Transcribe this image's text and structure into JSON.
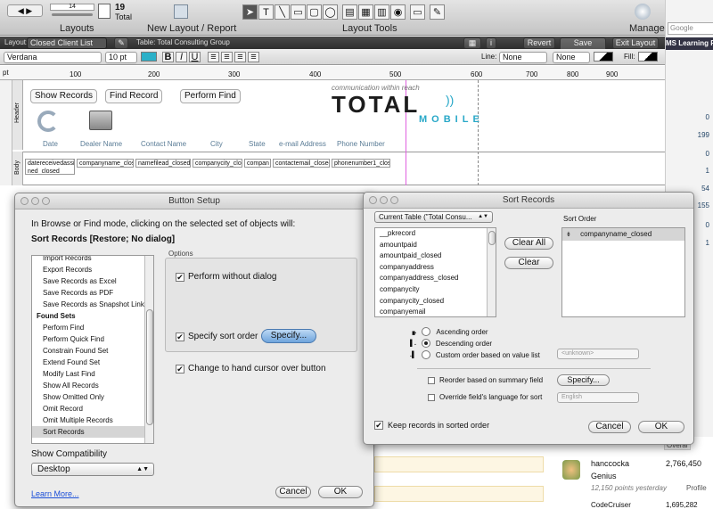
{
  "toolbar": {
    "record_number": "14",
    "record_count": "19",
    "record_total_label": "Total",
    "layouts_label": "Layouts",
    "new_layout_label": "New Layout / Report",
    "layout_tools_label": "Layout Tools",
    "manage_label": "Manage",
    "search_placeholder": "Google"
  },
  "layout_bar": {
    "layout_label": "Layout:",
    "layout_value": "Closed Client List",
    "table_label": "Table: Total Consulting Group",
    "revert_label": "Revert",
    "save_label": "Save Layout",
    "exit_label": "Exit Layout"
  },
  "format_bar": {
    "font": "Verdana",
    "size": "10 pt",
    "line_label": "Line:",
    "line_value": "None",
    "line_value2": "None",
    "fill_label": "Fill:"
  },
  "ruler": {
    "unit": "pt",
    "ticks": [
      "100",
      "200",
      "300",
      "400",
      "500",
      "600",
      "700",
      "800",
      "900"
    ]
  },
  "layout_canvas": {
    "buttons": [
      "Show Records",
      "Find Record",
      "Perform Find"
    ],
    "tagline": "communication within reach",
    "logo_main": "TOTAL",
    "logo_sub": "MOBILE",
    "headers": [
      "Date",
      "Dealer Name",
      "Contact Name",
      "City",
      "State",
      "e-mail Address",
      "Phone Number"
    ],
    "fields": [
      "datereceivedassig ned_closed",
      "companyname_clos",
      "namefilead_closed",
      "companycity_clos",
      "compan",
      "contactemail_closed",
      "phonenumber1_clos"
    ],
    "header_part": "Header",
    "body_part": "Body",
    "part_marker": "100"
  },
  "sidebar": {
    "title": "MS Learning Pl",
    "numbers": [
      "0",
      "199",
      "0",
      "1",
      "54",
      "155",
      "0",
      "1"
    ]
  },
  "background_panel": {
    "overall": "Overal",
    "user_name": "hanccocka",
    "user_points": "2,766,450",
    "user_rank": "Genius",
    "user_yesterday": "12,150 points yesterday",
    "profile_link": "Profile",
    "next_user": "CodeCruiser",
    "next_points": "1,695,282"
  },
  "button_setup": {
    "title": "Button Setup",
    "description": "In Browse or Find mode, clicking on the selected set of objects will:",
    "action": "Sort Records [Restore; No dialog]",
    "commands": [
      {
        "label": "Import Records",
        "type": "item"
      },
      {
        "label": "Export Records",
        "type": "item"
      },
      {
        "label": "Save Records as Excel",
        "type": "item"
      },
      {
        "label": "Save Records as PDF",
        "type": "item"
      },
      {
        "label": "Save Records as Snapshot Link",
        "type": "item"
      },
      {
        "label": "Found Sets",
        "type": "cat"
      },
      {
        "label": "Perform Find",
        "type": "item"
      },
      {
        "label": "Perform Quick Find",
        "type": "item"
      },
      {
        "label": "Constrain Found Set",
        "type": "item"
      },
      {
        "label": "Extend Found Set",
        "type": "item"
      },
      {
        "label": "Modify Last Find",
        "type": "item"
      },
      {
        "label": "Show All Records",
        "type": "item"
      },
      {
        "label": "Show Omitted Only",
        "type": "item"
      },
      {
        "label": "Omit Record",
        "type": "item"
      },
      {
        "label": "Omit Multiple Records",
        "type": "item"
      },
      {
        "label": "Sort Records",
        "type": "sel"
      }
    ],
    "options_label": "Options",
    "perform_without_dialog": "Perform without dialog",
    "specify_sort_order": "Specify sort order",
    "specify_button": "Specify...",
    "hand_cursor": "Change to hand cursor over button",
    "show_compat_label": "Show Compatibility",
    "compat_value": "Desktop",
    "learn_more": "Learn More...",
    "cancel": "Cancel",
    "ok": "OK"
  },
  "sort_records": {
    "title": "Sort Records",
    "table_selector": "Current Table (\"Total Consu...",
    "fields": [
      "__pkrecord",
      "amountpaid",
      "amountpaid_closed",
      "companyaddress",
      "companyaddress_closed",
      "companycity",
      "companycity_closed",
      "companyemail"
    ],
    "sort_order_label": "Sort Order",
    "sort_fields": [
      "companyname_closed"
    ],
    "clear_all": "Clear All",
    "clear": "Clear",
    "ascending": "Ascending order",
    "descending": "Descending order",
    "custom": "Custom order based on value list",
    "custom_value": "<unknown>",
    "reorder_summary": "Reorder based on summary field",
    "specify": "Specify...",
    "override_language": "Override field's language for sort",
    "language_value": "English",
    "keep_sorted": "Keep records in sorted order",
    "cancel": "Cancel",
    "ok": "OK"
  }
}
